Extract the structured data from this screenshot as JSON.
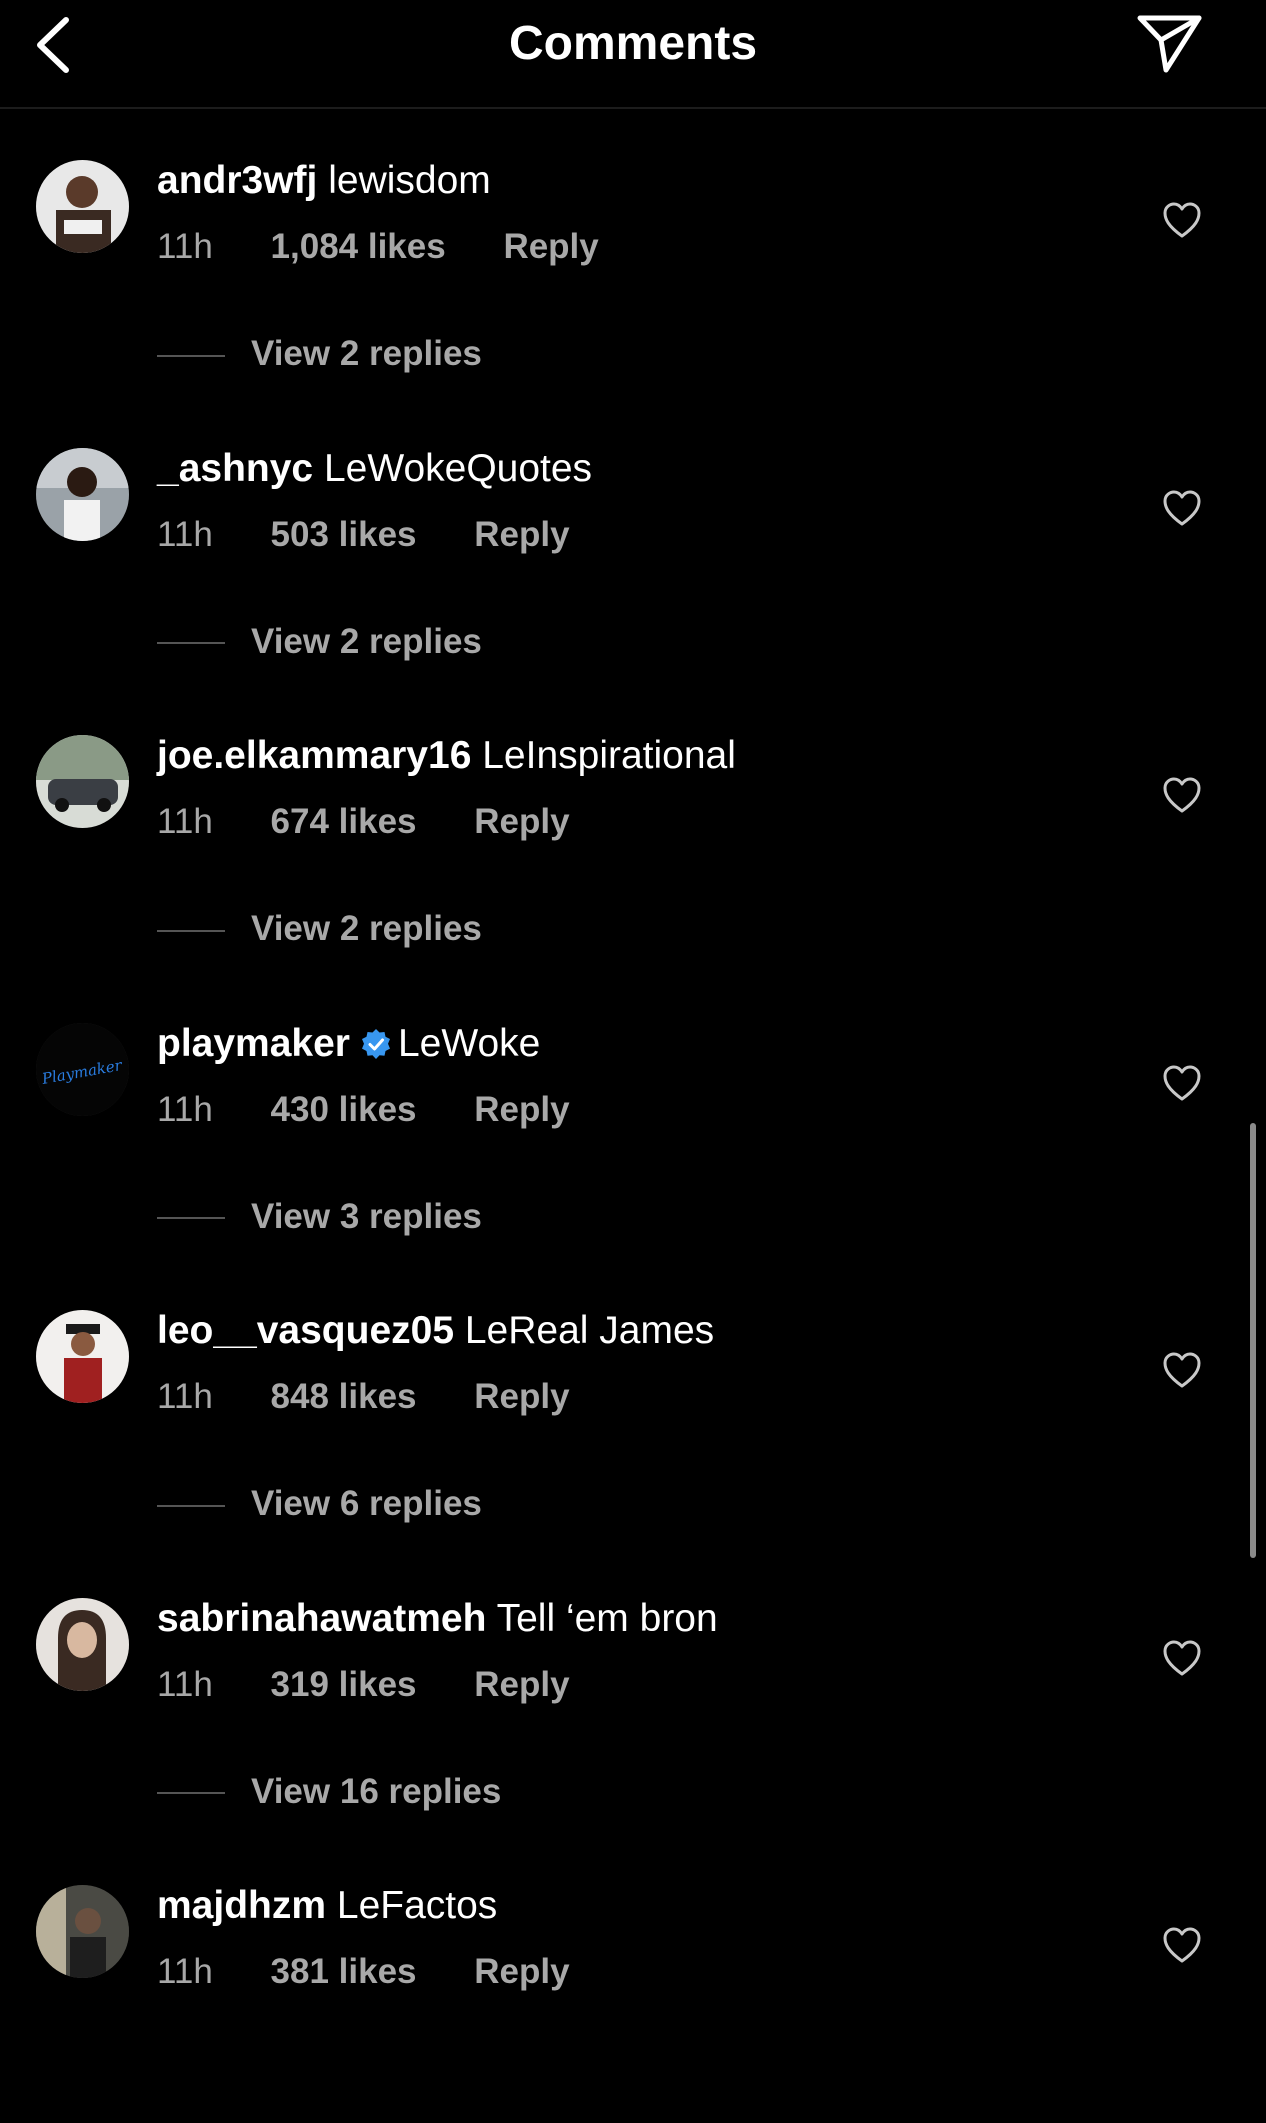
{
  "header": {
    "title": "Comments",
    "back_icon": "chevron-left-icon",
    "share_icon": "paper-plane-icon"
  },
  "colors": {
    "background": "#000000",
    "text": "#ffffff",
    "secondary_text": "#a8a8a8",
    "verified": "#3897f0"
  },
  "comments": [
    {
      "username": "andr3wfj",
      "text": "lewisdom",
      "time": "11h",
      "likes": "1,084 likes",
      "reply": "Reply",
      "view_replies": "View 2 replies",
      "verified": false
    },
    {
      "username": "_ashnyc",
      "text": "LeWokeQuotes",
      "time": "11h",
      "likes": "503 likes",
      "reply": "Reply",
      "view_replies": "View 2 replies",
      "verified": false
    },
    {
      "username": "joe.elkammary16",
      "text": "LeInspirational",
      "time": "11h",
      "likes": "674 likes",
      "reply": "Reply",
      "view_replies": "View 2 replies",
      "verified": false
    },
    {
      "username": "playmaker",
      "text": "LeWoke",
      "time": "11h",
      "likes": "430 likes",
      "reply": "Reply",
      "view_replies": "View 3 replies",
      "verified": true,
      "avatar_text": "Playmaker"
    },
    {
      "username": "leo__vasquez05",
      "text": "LeReal James",
      "time": "11h",
      "likes": "848 likes",
      "reply": "Reply",
      "view_replies": "View 6 replies",
      "verified": false
    },
    {
      "username": "sabrinahawatmeh",
      "text": "Tell ‘em bron",
      "time": "11h",
      "likes": "319 likes",
      "reply": "Reply",
      "view_replies": "View 16 replies",
      "verified": false
    },
    {
      "username": "majdhzm",
      "text": "LeFactos",
      "time": "11h",
      "likes": "381 likes",
      "reply": "Reply",
      "view_replies": "",
      "verified": false
    }
  ]
}
